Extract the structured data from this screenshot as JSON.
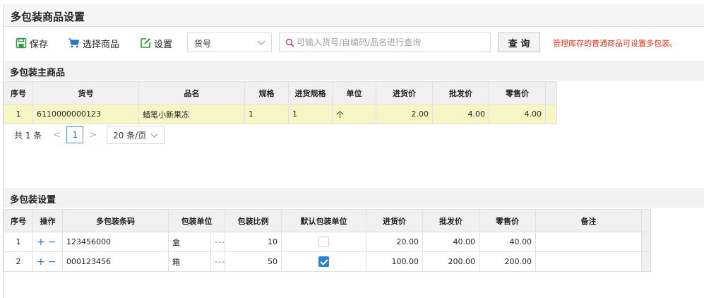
{
  "page": {
    "title": "多包装商品设置"
  },
  "toolbar": {
    "save_label": "保存",
    "select_goods_label": "选择商品",
    "settings_label": "设置",
    "field_select_value": "货号",
    "search_placeholder": "可输入货号/自编码/品名进行查询",
    "query_label": "查 询",
    "tip": "管理库存的普通商品可设置多包装。"
  },
  "main_section": {
    "title": "多包装主商品",
    "columns": [
      "序号",
      "货号",
      "品名",
      "规格",
      "进货规格",
      "单位",
      "进货价",
      "批发价",
      "零售价"
    ],
    "rows": [
      [
        "1",
        "6110000000123",
        "蜡笔小新果冻",
        "1",
        "1",
        "个",
        "2.00",
        "4.00",
        "4.00"
      ]
    ]
  },
  "pager": {
    "total_label": "共 1 条",
    "prev": "<",
    "page": "1",
    "next": ">",
    "page_size": "20 条/页"
  },
  "pack_section": {
    "title": "多包装设置",
    "columns": [
      "序号",
      "操作",
      "多包装条码",
      "包装单位",
      "包装比例",
      "默认包装单位",
      "进货价",
      "批发价",
      "零售价",
      "备注"
    ],
    "rows": [
      {
        "no": "1",
        "op_add": "+",
        "op_remove": "−",
        "barcode": "123456000",
        "unit": "盒",
        "unit_more": "---",
        "ratio": "10",
        "default": false,
        "purchase": "20.00",
        "wholesale": "40.00",
        "retail": "40.00",
        "remark": ""
      },
      {
        "no": "2",
        "op_add": "+",
        "op_remove": "−",
        "barcode": "000123456",
        "unit": "箱",
        "unit_more": "---",
        "ratio": "50",
        "default": true,
        "purchase": "100.00",
        "wholesale": "200.00",
        "retail": "200.00",
        "remark": ""
      }
    ]
  },
  "icons": {
    "save": "floppy-icon",
    "select_goods": "cart-icon",
    "settings": "edit-icon",
    "search": "search-icon",
    "chevron": "chevron-down-icon"
  },
  "colors": {
    "accent_green": "#2a9a3a",
    "accent_blue": "#2a73c9",
    "tip_red": "#e0301e",
    "selected_row": "#f8f5c4"
  }
}
